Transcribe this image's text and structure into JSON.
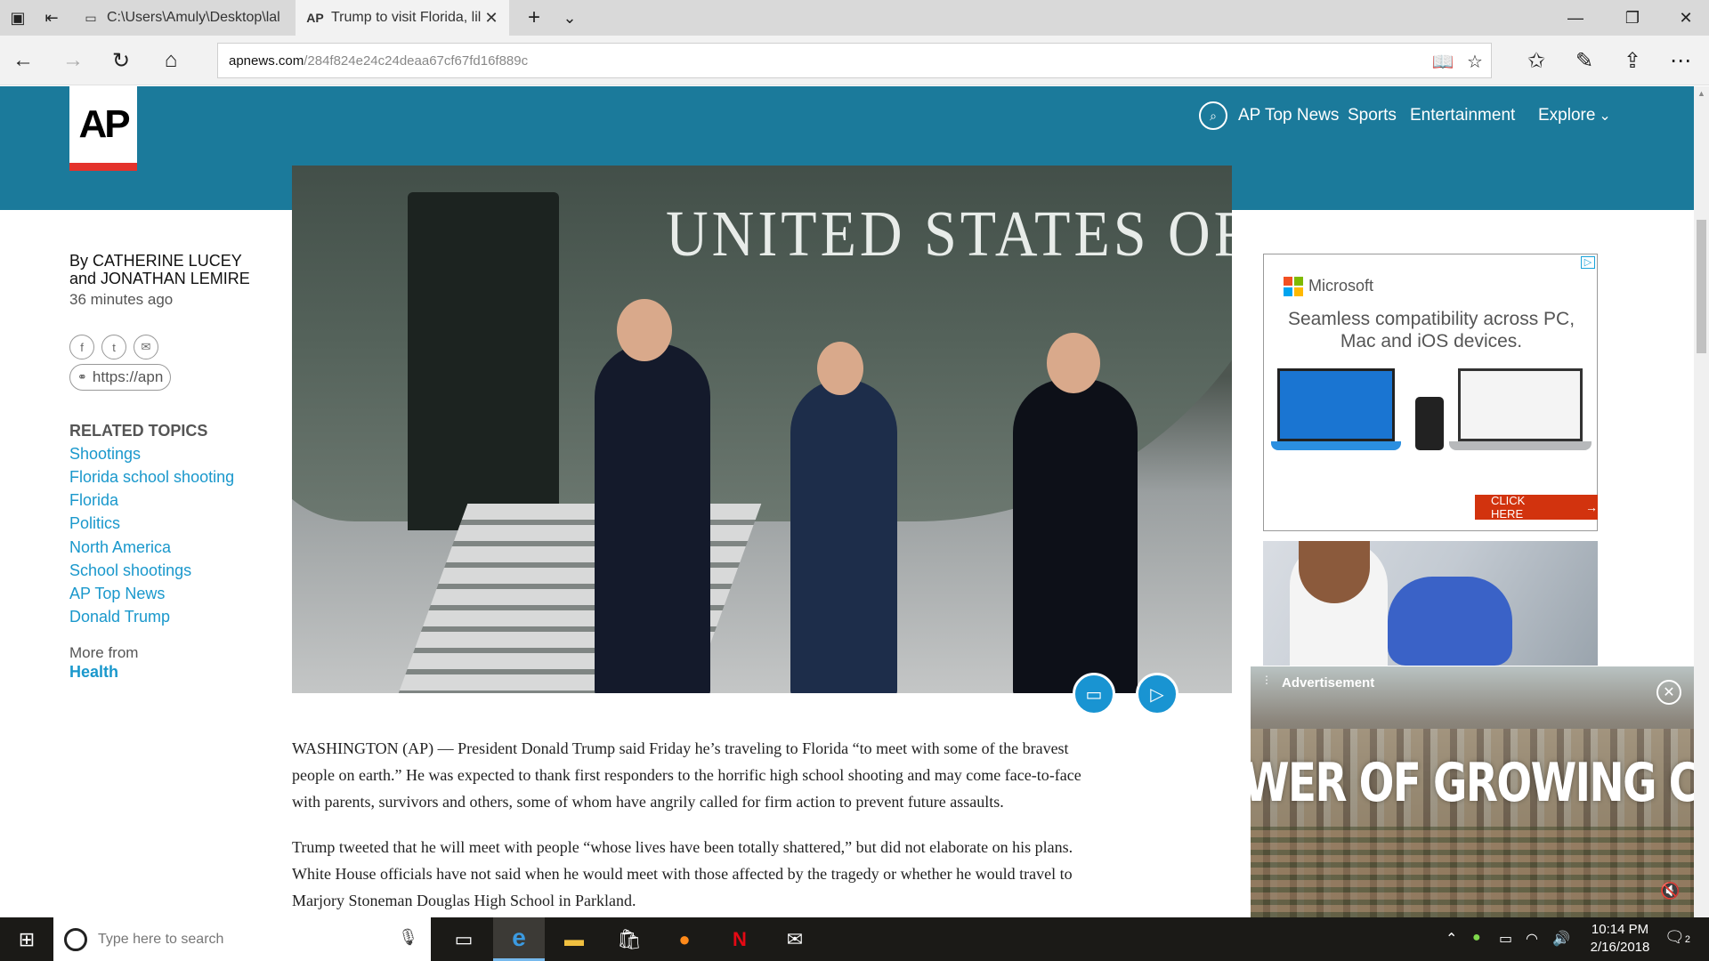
{
  "browser": {
    "tabs": [
      {
        "favicon": "file-icon",
        "title": "C:\\Users\\Amuly\\Desktop\\lal"
      },
      {
        "favicon": "AP",
        "title": "Trump to visit Florida, lil"
      }
    ],
    "address": {
      "host": "apnews.com",
      "path": "/284f824e24c24deaa67cf67fd16f889c"
    }
  },
  "site": {
    "logo": "AP",
    "nav": {
      "top_news": "AP Top News",
      "sports": "Sports",
      "entertainment": "Entertainment",
      "explore": "Explore"
    }
  },
  "article": {
    "byline_1": "By CATHERINE LUCEY",
    "byline_2": "and JONATHAN LEMIRE",
    "timestamp": "36 minutes ago",
    "share_link": "https://apn",
    "hero_text": "UNITED STATES OF AMERIC",
    "related_title": "RELATED TOPICS",
    "related_topics": [
      "Shootings",
      "Florida school shooting",
      "Florida",
      "Politics",
      "North America",
      "School shootings",
      "AP Top News",
      "Donald Trump"
    ],
    "more_from": "More from",
    "more_from_section": "Health",
    "paragraphs": [
      [
        "WASHINGTON (AP) — President Donald Trump said Friday he’s traveling to Florida “to meet with some of the bravest",
        "people on earth.” He was expected to thank first responders to the horrific high school shooting and may come face-to-face",
        "with parents, survivors and others, some of whom have angrily called for firm action to prevent future assaults."
      ],
      [
        "Trump tweeted that he will meet with people “whose lives have been totally shattered,” but did not elaborate on his plans.",
        "White House officials have not said when he would meet with those affected by the tragedy or whether he would travel to",
        "Marjory Stoneman Douglas High School in Parkland."
      ]
    ]
  },
  "ads": {
    "microsoft": {
      "brand": "Microsoft",
      "text": "Seamless compatibility across PC, Mac and iOS devices.",
      "cta": "CLICK HERE"
    },
    "video": {
      "label": "Advertisement",
      "headline": "WER OF GROWING CI"
    }
  },
  "taskbar": {
    "search_placeholder": "Type here to search",
    "time": "10:14 PM",
    "date": "2/16/2018",
    "notifications": "2"
  },
  "colors": {
    "ap_teal": "#1b7a9b",
    "ap_red": "#e4322b",
    "link_blue": "#1a98cc",
    "ms_cta": "#d2330e"
  }
}
